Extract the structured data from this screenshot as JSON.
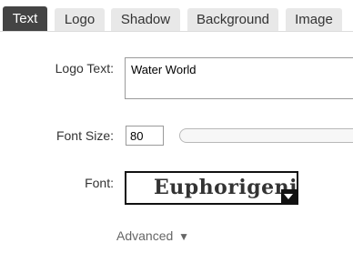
{
  "tabs": [
    {
      "label": "Text",
      "active": true
    },
    {
      "label": "Logo",
      "active": false
    },
    {
      "label": "Shadow",
      "active": false
    },
    {
      "label": "Background",
      "active": false
    },
    {
      "label": "Image",
      "active": false
    }
  ],
  "form": {
    "logo_text_label": "Logo Text:",
    "logo_text_value": "Water World",
    "font_size_label": "Font Size:",
    "font_size_value": "80",
    "font_label": "Font:",
    "font_selected": "Euphorigenic"
  },
  "advanced": {
    "label": "Advanced",
    "caret": "▼"
  },
  "colors": {
    "active_tab_bg": "#444444",
    "inactive_tab_bg": "#e8e8e8",
    "text": "#333333",
    "muted_text": "#666666"
  }
}
